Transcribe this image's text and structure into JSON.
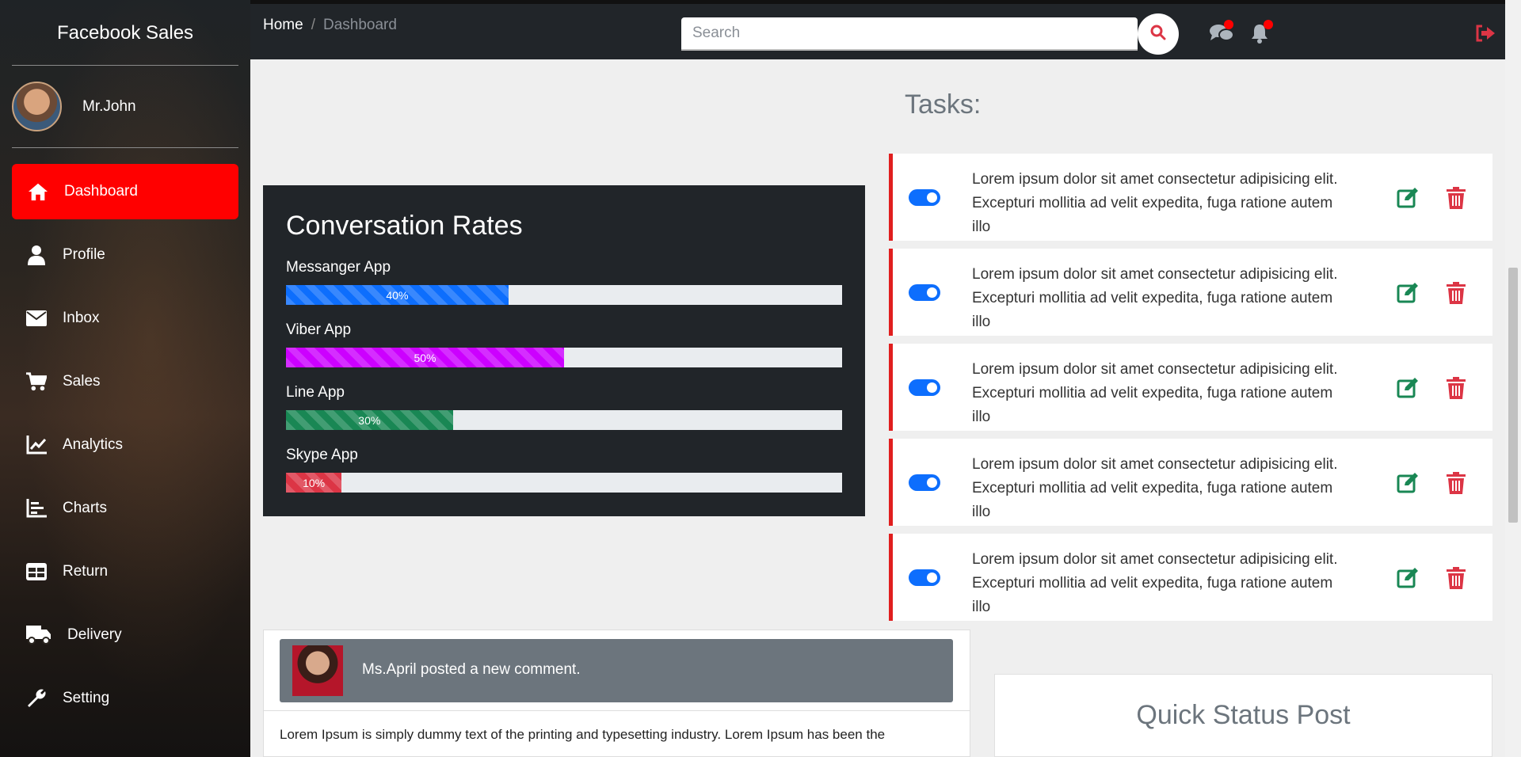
{
  "sidebar": {
    "brand": "Facebook Sales",
    "user_name": "Mr.John",
    "items": [
      {
        "label": "Dashboard",
        "icon": "home-icon",
        "active": true
      },
      {
        "label": "Profile",
        "icon": "user-icon"
      },
      {
        "label": "Inbox",
        "icon": "envelope-icon"
      },
      {
        "label": "Sales",
        "icon": "cart-icon"
      },
      {
        "label": "Analytics",
        "icon": "line-chart-icon"
      },
      {
        "label": "Charts",
        "icon": "bar-chart-icon"
      },
      {
        "label": "Return",
        "icon": "table-icon"
      },
      {
        "label": "Delivery",
        "icon": "truck-icon"
      },
      {
        "label": "Setting",
        "icon": "wrench-icon"
      }
    ]
  },
  "topbar": {
    "breadcrumb_home": "Home",
    "breadcrumb_sep": "/",
    "breadcrumb_current": "Dashboard",
    "search_placeholder": "Search"
  },
  "tasks": {
    "title": "Tasks:",
    "items": [
      {
        "text": "Lorem ipsum dolor sit amet consectetur adipisicing elit. Excepturi mollitia ad velit expedita, fuga ratione autem illo",
        "enabled": true
      },
      {
        "text": "Lorem ipsum dolor sit amet consectetur adipisicing elit. Excepturi mollitia ad velit expedita, fuga ratione autem illo",
        "enabled": true
      },
      {
        "text": "Lorem ipsum dolor sit amet consectetur adipisicing elit. Excepturi mollitia ad velit expedita, fuga ratione autem illo",
        "enabled": true
      },
      {
        "text": "Lorem ipsum dolor sit amet consectetur adipisicing elit. Excepturi mollitia ad velit expedita, fuga ratione autem illo",
        "enabled": true
      },
      {
        "text": "Lorem ipsum dolor sit amet consectetur adipisicing elit. Excepturi mollitia ad velit expedita, fuga ratione autem illo",
        "enabled": true
      }
    ]
  },
  "conversation": {
    "title": "Conversation Rates",
    "rates": [
      {
        "label": "Messanger App",
        "value": 40,
        "text": "40%",
        "color": "#0d6efd"
      },
      {
        "label": "Viber App",
        "value": 50,
        "text": "50%",
        "color": "#cc00ff"
      },
      {
        "label": "Line App",
        "value": 30,
        "text": "30%",
        "color": "#198754"
      },
      {
        "label": "Skype App",
        "value": 10,
        "text": "10%",
        "color": "#dc3545"
      }
    ]
  },
  "comment": {
    "header": "Ms.April posted a new comment.",
    "body": "Lorem Ipsum is simply dummy text of the printing and typesetting industry. Lorem Ipsum has been the"
  },
  "quick_status": {
    "title": "Quick Status Post"
  },
  "colors": {
    "accent": "#ff0000",
    "dark": "#212529",
    "toggle": "#0d6efd",
    "edit": "#198754",
    "delete": "#dc3545"
  }
}
